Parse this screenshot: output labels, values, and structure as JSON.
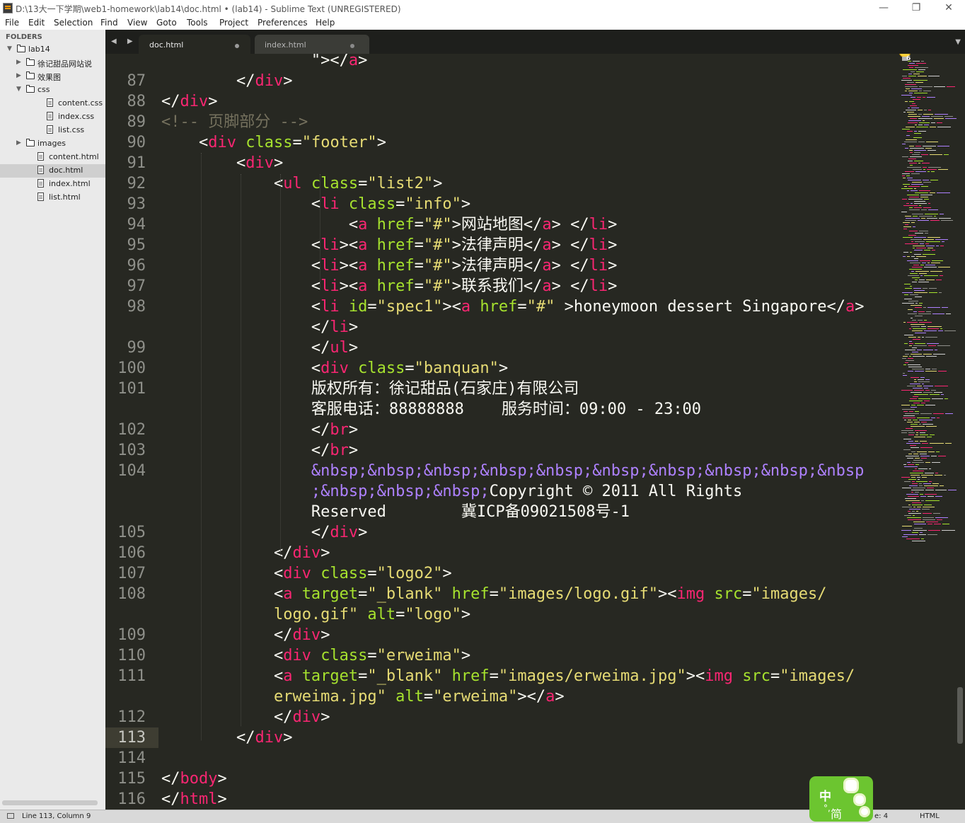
{
  "window": {
    "title": "D:\\13大一下学期\\web1-homework\\lab14\\doc.html • (lab14) - Sublime Text (UNREGISTERED)",
    "minimize": "—",
    "restore": "❐",
    "close": "✕"
  },
  "menu": [
    "File",
    "Edit",
    "Selection",
    "Find",
    "View",
    "Goto",
    "Tools",
    "Project",
    "Preferences",
    "Help"
  ],
  "sidebar": {
    "header": "FOLDERS",
    "items": [
      {
        "label": "lab14",
        "type": "folder",
        "open": true,
        "depth": 0
      },
      {
        "label": "徐记甜品网站说",
        "type": "folder",
        "open": false,
        "depth": 1
      },
      {
        "label": "效果图",
        "type": "folder",
        "open": false,
        "depth": 1
      },
      {
        "label": "css",
        "type": "folder",
        "open": true,
        "depth": 1
      },
      {
        "label": "content.css",
        "type": "file",
        "depth": 2
      },
      {
        "label": "index.css",
        "type": "file",
        "depth": 2
      },
      {
        "label": "list.css",
        "type": "file",
        "depth": 2
      },
      {
        "label": "images",
        "type": "folder",
        "open": false,
        "depth": 1
      },
      {
        "label": "content.html",
        "type": "file",
        "depth": 1
      },
      {
        "label": "doc.html",
        "type": "file",
        "depth": 1,
        "selected": true
      },
      {
        "label": "index.html",
        "type": "file",
        "depth": 1
      },
      {
        "label": "list.html",
        "type": "file",
        "depth": 1
      }
    ]
  },
  "tabs": [
    {
      "label": "doc.html",
      "active": true
    },
    {
      "label": "index.html",
      "active": false
    }
  ],
  "tab_nav": "◀ ▶",
  "tab_menu": "▼",
  "editor": {
    "current_line": "113",
    "lines": [
      {
        "num": "",
        "tokens": [
          [
            "pun",
            "                \">"
          ],
          [
            "pun",
            "</"
          ],
          [
            "tag",
            "a"
          ],
          [
            "pun",
            ">"
          ]
        ]
      },
      {
        "num": "87",
        "tokens": [
          [
            "pun",
            "        </"
          ],
          [
            "tag",
            "div"
          ],
          [
            "pun",
            ">"
          ]
        ]
      },
      {
        "num": "88",
        "tokens": [
          [
            "pun",
            "</"
          ],
          [
            "tag",
            "div"
          ],
          [
            "pun",
            ">"
          ]
        ]
      },
      {
        "num": "89",
        "tokens": [
          [
            "com",
            "<!-- 页脚部分 -->"
          ]
        ]
      },
      {
        "num": "90",
        "tokens": [
          [
            "pun",
            "    <"
          ],
          [
            "tag",
            "div"
          ],
          [
            "pun",
            " "
          ],
          [
            "attr",
            "class"
          ],
          [
            "pun",
            "="
          ],
          [
            "str",
            "\"footer\""
          ],
          [
            "pun",
            ">"
          ]
        ]
      },
      {
        "num": "91",
        "tokens": [
          [
            "pun",
            "        <"
          ],
          [
            "tag",
            "div"
          ],
          [
            "pun",
            ">"
          ]
        ]
      },
      {
        "num": "92",
        "tokens": [
          [
            "pun",
            "            <"
          ],
          [
            "tag",
            "ul"
          ],
          [
            "pun",
            " "
          ],
          [
            "attr",
            "class"
          ],
          [
            "pun",
            "="
          ],
          [
            "str",
            "\"list2\""
          ],
          [
            "pun",
            ">"
          ]
        ]
      },
      {
        "num": "93",
        "tokens": [
          [
            "pun",
            "                <"
          ],
          [
            "tag",
            "li"
          ],
          [
            "pun",
            " "
          ],
          [
            "attr",
            "class"
          ],
          [
            "pun",
            "="
          ],
          [
            "str",
            "\"info\""
          ],
          [
            "pun",
            ">"
          ]
        ]
      },
      {
        "num": "94",
        "tokens": [
          [
            "pun",
            "                    <"
          ],
          [
            "tag",
            "a"
          ],
          [
            "pun",
            " "
          ],
          [
            "attr",
            "href"
          ],
          [
            "pun",
            "="
          ],
          [
            "str",
            "\"#\""
          ],
          [
            "pun",
            ">网站地图</"
          ],
          [
            "tag",
            "a"
          ],
          [
            "pun",
            "> </"
          ],
          [
            "tag",
            "li"
          ],
          [
            "pun",
            ">"
          ]
        ]
      },
      {
        "num": "95",
        "tokens": [
          [
            "pun",
            "                <"
          ],
          [
            "tag",
            "li"
          ],
          [
            "pun",
            "><"
          ],
          [
            "tag",
            "a"
          ],
          [
            "pun",
            " "
          ],
          [
            "attr",
            "href"
          ],
          [
            "pun",
            "="
          ],
          [
            "str",
            "\"#\""
          ],
          [
            "pun",
            ">法律声明</"
          ],
          [
            "tag",
            "a"
          ],
          [
            "pun",
            "> </"
          ],
          [
            "tag",
            "li"
          ],
          [
            "pun",
            ">"
          ]
        ]
      },
      {
        "num": "96",
        "tokens": [
          [
            "pun",
            "                <"
          ],
          [
            "tag",
            "li"
          ],
          [
            "pun",
            "><"
          ],
          [
            "tag",
            "a"
          ],
          [
            "pun",
            " "
          ],
          [
            "attr",
            "href"
          ],
          [
            "pun",
            "="
          ],
          [
            "str",
            "\"#\""
          ],
          [
            "pun",
            ">法律声明</"
          ],
          [
            "tag",
            "a"
          ],
          [
            "pun",
            "> </"
          ],
          [
            "tag",
            "li"
          ],
          [
            "pun",
            ">"
          ]
        ]
      },
      {
        "num": "97",
        "tokens": [
          [
            "pun",
            "                <"
          ],
          [
            "tag",
            "li"
          ],
          [
            "pun",
            "><"
          ],
          [
            "tag",
            "a"
          ],
          [
            "pun",
            " "
          ],
          [
            "attr",
            "href"
          ],
          [
            "pun",
            "="
          ],
          [
            "str",
            "\"#\""
          ],
          [
            "pun",
            ">联系我们</"
          ],
          [
            "tag",
            "a"
          ],
          [
            "pun",
            "> </"
          ],
          [
            "tag",
            "li"
          ],
          [
            "pun",
            ">"
          ]
        ]
      },
      {
        "num": "98",
        "tokens": [
          [
            "pun",
            "                <"
          ],
          [
            "tag",
            "li"
          ],
          [
            "pun",
            " "
          ],
          [
            "attr",
            "id"
          ],
          [
            "pun",
            "="
          ],
          [
            "str",
            "\"spec1\""
          ],
          [
            "pun",
            "><"
          ],
          [
            "tag",
            "a"
          ],
          [
            "pun",
            " "
          ],
          [
            "attr",
            "href"
          ],
          [
            "pun",
            "="
          ],
          [
            "str",
            "\"#\""
          ],
          [
            "pun",
            " >honeymoon dessert Singapore</"
          ],
          [
            "tag",
            "a"
          ],
          [
            "pun",
            ">"
          ]
        ]
      },
      {
        "num": "",
        "tokens": [
          [
            "pun",
            "                </"
          ],
          [
            "tag",
            "li"
          ],
          [
            "pun",
            ">"
          ]
        ]
      },
      {
        "num": "99",
        "tokens": [
          [
            "pun",
            "                </"
          ],
          [
            "tag",
            "ul"
          ],
          [
            "pun",
            ">"
          ]
        ]
      },
      {
        "num": "100",
        "tokens": [
          [
            "pun",
            "                <"
          ],
          [
            "tag",
            "div"
          ],
          [
            "pun",
            " "
          ],
          [
            "attr",
            "class"
          ],
          [
            "pun",
            "="
          ],
          [
            "str",
            "\"banquan\""
          ],
          [
            "pun",
            ">"
          ]
        ]
      },
      {
        "num": "101",
        "tokens": [
          [
            "pun",
            "                版权所有：徐记甜品(石家庄)有限公司"
          ]
        ]
      },
      {
        "num": "",
        "tokens": [
          [
            "pun",
            "                客服电话：88888888    服务时间：09:00 - 23:00"
          ]
        ]
      },
      {
        "num": "102",
        "tokens": [
          [
            "pun",
            "                </"
          ],
          [
            "tag",
            "br"
          ],
          [
            "pun",
            ">"
          ]
        ]
      },
      {
        "num": "103",
        "tokens": [
          [
            "pun",
            "                </"
          ],
          [
            "tag",
            "br"
          ],
          [
            "pun",
            ">"
          ]
        ]
      },
      {
        "num": "104",
        "tokens": [
          [
            "pun",
            "                "
          ],
          [
            "ent",
            "&nbsp;&nbsp;&nbsp;&nbsp;&nbsp;&nbsp;&nbsp;&nbsp;&nbsp;&nbsp"
          ]
        ]
      },
      {
        "num": "",
        "tokens": [
          [
            "pun",
            "                "
          ],
          [
            "ent",
            ";&nbsp;&nbsp;&nbsp;"
          ],
          [
            "pun",
            "Copyright © 2011 All Rights"
          ]
        ]
      },
      {
        "num": "",
        "tokens": [
          [
            "pun",
            "                Reserved        冀ICP备09021508号-1"
          ]
        ]
      },
      {
        "num": "105",
        "tokens": [
          [
            "pun",
            "                </"
          ],
          [
            "tag",
            "div"
          ],
          [
            "pun",
            ">"
          ]
        ]
      },
      {
        "num": "106",
        "tokens": [
          [
            "pun",
            "            </"
          ],
          [
            "tag",
            "div"
          ],
          [
            "pun",
            ">"
          ]
        ]
      },
      {
        "num": "107",
        "tokens": [
          [
            "pun",
            "            <"
          ],
          [
            "tag",
            "div"
          ],
          [
            "pun",
            " "
          ],
          [
            "attr",
            "class"
          ],
          [
            "pun",
            "="
          ],
          [
            "str",
            "\"logo2\""
          ],
          [
            "pun",
            ">"
          ]
        ]
      },
      {
        "num": "108",
        "tokens": [
          [
            "pun",
            "            <"
          ],
          [
            "tag",
            "a"
          ],
          [
            "pun",
            " "
          ],
          [
            "attr",
            "target"
          ],
          [
            "pun",
            "="
          ],
          [
            "str",
            "\"_blank\""
          ],
          [
            "pun",
            " "
          ],
          [
            "attr",
            "href"
          ],
          [
            "pun",
            "="
          ],
          [
            "str",
            "\"images/logo.gif\""
          ],
          [
            "pun",
            "><"
          ],
          [
            "tag",
            "img"
          ],
          [
            "pun",
            " "
          ],
          [
            "attr",
            "src"
          ],
          [
            "pun",
            "="
          ],
          [
            "str",
            "\"images/"
          ]
        ]
      },
      {
        "num": "",
        "tokens": [
          [
            "pun",
            "            "
          ],
          [
            "str",
            "logo.gif\""
          ],
          [
            "pun",
            " "
          ],
          [
            "attr",
            "alt"
          ],
          [
            "pun",
            "="
          ],
          [
            "str",
            "\"logo\""
          ],
          [
            "pun",
            ">"
          ]
        ]
      },
      {
        "num": "109",
        "tokens": [
          [
            "pun",
            "            </"
          ],
          [
            "tag",
            "div"
          ],
          [
            "pun",
            ">"
          ]
        ]
      },
      {
        "num": "110",
        "tokens": [
          [
            "pun",
            "            <"
          ],
          [
            "tag",
            "div"
          ],
          [
            "pun",
            " "
          ],
          [
            "attr",
            "class"
          ],
          [
            "pun",
            "="
          ],
          [
            "str",
            "\"erweima\""
          ],
          [
            "pun",
            ">"
          ]
        ]
      },
      {
        "num": "111",
        "tokens": [
          [
            "pun",
            "            <"
          ],
          [
            "tag",
            "a"
          ],
          [
            "pun",
            " "
          ],
          [
            "attr",
            "target"
          ],
          [
            "pun",
            "="
          ],
          [
            "str",
            "\"_blank\""
          ],
          [
            "pun",
            " "
          ],
          [
            "attr",
            "href"
          ],
          [
            "pun",
            "="
          ],
          [
            "str",
            "\"images/erweima.jpg\""
          ],
          [
            "pun",
            "><"
          ],
          [
            "tag",
            "img"
          ],
          [
            "pun",
            " "
          ],
          [
            "attr",
            "src"
          ],
          [
            "pun",
            "="
          ],
          [
            "str",
            "\"images/"
          ]
        ]
      },
      {
        "num": "",
        "tokens": [
          [
            "pun",
            "            "
          ],
          [
            "str",
            "erweima.jpg\""
          ],
          [
            "pun",
            " "
          ],
          [
            "attr",
            "alt"
          ],
          [
            "pun",
            "="
          ],
          [
            "str",
            "\"erweima\""
          ],
          [
            "pun",
            "></"
          ],
          [
            "tag",
            "a"
          ],
          [
            "pun",
            ">"
          ]
        ]
      },
      {
        "num": "112",
        "tokens": [
          [
            "pun",
            "            </"
          ],
          [
            "tag",
            "div"
          ],
          [
            "pun",
            ">"
          ]
        ]
      },
      {
        "num": "113",
        "tokens": [
          [
            "pun",
            "        </"
          ],
          [
            "tag",
            "div"
          ],
          [
            "pun",
            ">"
          ]
        ]
      },
      {
        "num": "114",
        "tokens": []
      },
      {
        "num": "115",
        "tokens": [
          [
            "pun",
            "</"
          ],
          [
            "tag",
            "body"
          ],
          [
            "pun",
            ">"
          ]
        ]
      },
      {
        "num": "116",
        "tokens": [
          [
            "pun",
            "</"
          ],
          [
            "tag",
            "html"
          ],
          [
            "pun",
            ">"
          ]
        ]
      }
    ]
  },
  "bulb_badge": "6",
  "status": {
    "position": "Line 113, Column 9",
    "tab_size": "e: 4",
    "syntax": "HTML"
  },
  "ime": {
    "char1": "中",
    "char2": "简",
    "dot": "°,"
  },
  "colors": {
    "bg": "#272822",
    "tag": "#f92672",
    "attr": "#a6e22e",
    "string": "#e6db74",
    "comment": "#75715e",
    "entity": "#ae81ff"
  }
}
